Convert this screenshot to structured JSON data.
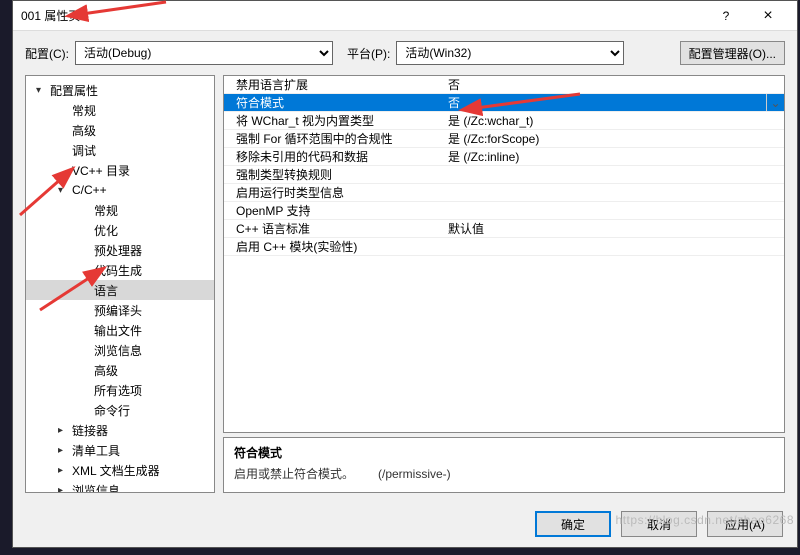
{
  "window": {
    "title": "001 属性页",
    "help": "?",
    "close": "×"
  },
  "configRow": {
    "configLabel": "配置(C):",
    "configValue": "活动(Debug)",
    "platformLabel": "平台(P):",
    "platformValue": "活动(Win32)",
    "configMgrBtn": "配置管理器(O)..."
  },
  "tree": {
    "items": [
      {
        "label": "配置属性",
        "indent": 0,
        "arrow": "▾"
      },
      {
        "label": "常规",
        "indent": 1
      },
      {
        "label": "高级",
        "indent": 1
      },
      {
        "label": "调试",
        "indent": 1
      },
      {
        "label": "VC++ 目录",
        "indent": 1
      },
      {
        "label": "C/C++",
        "indent": 1,
        "arrow": "▾"
      },
      {
        "label": "常规",
        "indent": 2
      },
      {
        "label": "优化",
        "indent": 2
      },
      {
        "label": "预处理器",
        "indent": 2
      },
      {
        "label": "代码生成",
        "indent": 2
      },
      {
        "label": "语言",
        "indent": 2,
        "selected": true
      },
      {
        "label": "预编译头",
        "indent": 2
      },
      {
        "label": "输出文件",
        "indent": 2
      },
      {
        "label": "浏览信息",
        "indent": 2
      },
      {
        "label": "高级",
        "indent": 2
      },
      {
        "label": "所有选项",
        "indent": 2
      },
      {
        "label": "命令行",
        "indent": 2
      },
      {
        "label": "链接器",
        "indent": 1,
        "arrow": "▸"
      },
      {
        "label": "清单工具",
        "indent": 1,
        "arrow": "▸"
      },
      {
        "label": "XML 文档生成器",
        "indent": 1,
        "arrow": "▸"
      },
      {
        "label": "浏览信息",
        "indent": 1,
        "arrow": "▸"
      }
    ]
  },
  "props": {
    "rows": [
      {
        "name": "禁用语言扩展",
        "value": "否"
      },
      {
        "name": "符合模式",
        "value": "否",
        "selected": true,
        "dropdown": true
      },
      {
        "name": "将 WChar_t 视为内置类型",
        "value": "是 (/Zc:wchar_t)"
      },
      {
        "name": "强制 For 循环范围中的合规性",
        "value": "是 (/Zc:forScope)"
      },
      {
        "name": "移除未引用的代码和数据",
        "value": "是 (/Zc:inline)"
      },
      {
        "name": "强制类型转换规则",
        "value": ""
      },
      {
        "name": "启用运行时类型信息",
        "value": ""
      },
      {
        "name": "OpenMP 支持",
        "value": ""
      },
      {
        "name": "C++ 语言标准",
        "value": "默认值"
      },
      {
        "name": "启用 C++ 模块(实验性)",
        "value": ""
      }
    ]
  },
  "desc": {
    "title": "符合模式",
    "body": "启用或禁止符合模式。  (/permissive-)"
  },
  "footer": {
    "ok": "确定",
    "cancel": "取消",
    "apply": "应用(A)"
  },
  "watermark": "https://blog.csdn.net/zhao6268"
}
